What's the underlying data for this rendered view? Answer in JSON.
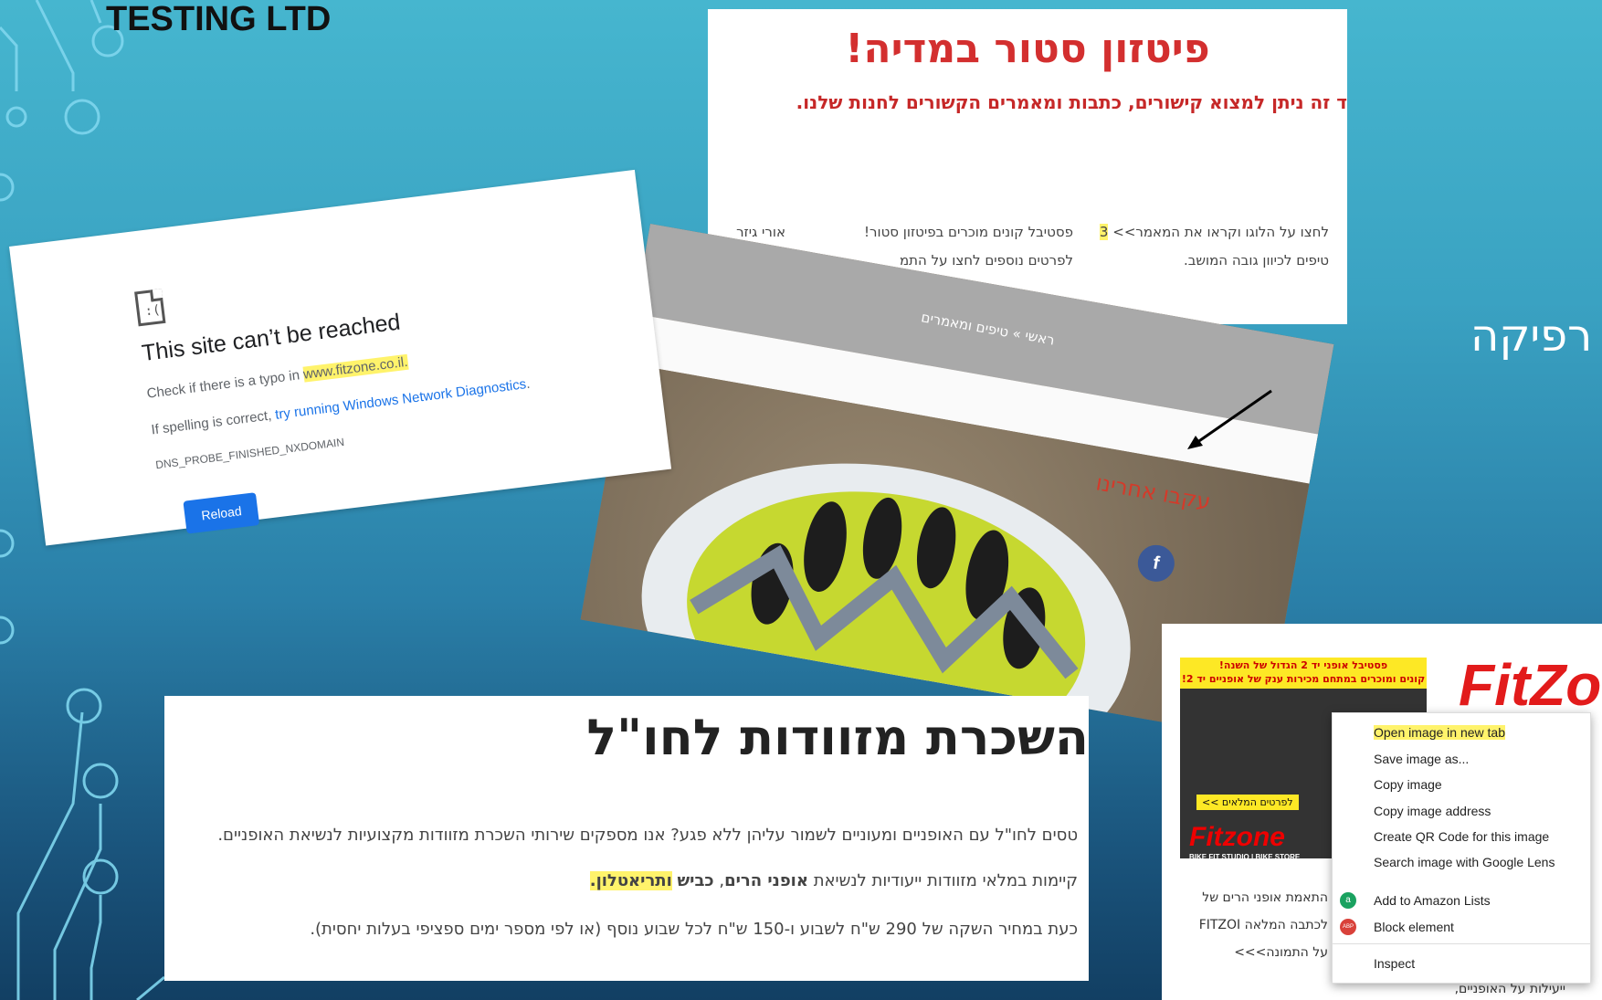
{
  "slide": {
    "company": "TESTING LTD",
    "side_text": "רפיקה"
  },
  "store_page": {
    "title": "פיטזון סטור במדיה!",
    "subtitle": "ד זה ניתן למצוא קישורים, כתבות ומאמרים הקשורים לחנות שלנו.",
    "col1_line1_text": "לחצו על הלוגו וקראו את המאמר>>",
    "col1_line1_num": "3",
    "col1_line2": "טיפים לכיוון גובה המושב.",
    "col2_line1": "פסטיבל קונים מוכרים בפיטזון סטור!",
    "col2_line2": "לפרטים נוספים לחצו על התמ",
    "col3_line1": "אורי גיזר"
  },
  "error_page": {
    "heading": "This site can’t be reached",
    "line1_prefix": "Check if there is a typo in ",
    "domain": "www.fitzone.co.il.",
    "line2_prefix": "If spelling is correct, ",
    "line2_link": "try running Windows Network Diagnostics",
    "line2_suffix": ".",
    "error_code": "DNS_PROBE_FINISHED_NXDOMAIN",
    "reload": "Reload"
  },
  "helmet_page": {
    "breadcrumb": "ראשי » טיפים ומאמרים",
    "follow_text": "עקבו אחרינו",
    "fb_letter": "f"
  },
  "luggage_page": {
    "title": "השכרת מזוודות לחו\"ל",
    "p1": "טסים לחו\"ל עם האופניים ומעוניים לשמור עליהן ללא פגע? אנו מספקים שירותי השכרת מזוודות מקצועיות לנשיאת האופניים.",
    "p2_a": "קיימות במלאי מזוודות ייעודיות לנשיאת ",
    "p2_b": "אופני הרים",
    "p2_c": ", ",
    "p2_d": "כביש",
    "p2_e": " ",
    "p2_f": "ותריאטלון.",
    "p3": "כעת במחיר השקה של 290 ש\"ח לשבוע ו-150 ש\"ח לכל שבוע נוסף (או לפי מספר ימים ספציפי בעלות יחסית)."
  },
  "context_panel": {
    "ad_top_line1": "פסטיבל אופני יד 2 הגדול של השנה!",
    "ad_top_line2": "קונים ומוכרים במתחם מכירות ענק של אופניים יד 2!",
    "ad_button": "לפרטים המלאים >>",
    "ad_logo": "Fitzone",
    "ad_logo_tag": "BIKE FIT STUDIO | BIKE STORE",
    "brand": "FitZo",
    "para1": "התאמת אופני הרים של",
    "para2": "לכתבה המלאה FITZOI",
    "para3": "על התמונה>>>",
    "para4": "ייעילות על האופניים,",
    "menu": {
      "open_new_tab": "Open image in new tab",
      "save_as": "Save image as...",
      "copy_image": "Copy image",
      "copy_address": "Copy image address",
      "qr": "Create QR Code for this image",
      "lens": "Search image with Google Lens",
      "amazon": "Add to Amazon Lists",
      "block": "Block element",
      "inspect": "Inspect",
      "amazon_icon": "a",
      "abp_icon": "ABP"
    }
  },
  "colors": {
    "accent_red": "#d32f2f",
    "link_blue": "#1a73e8",
    "highlight": "#fff36b"
  }
}
